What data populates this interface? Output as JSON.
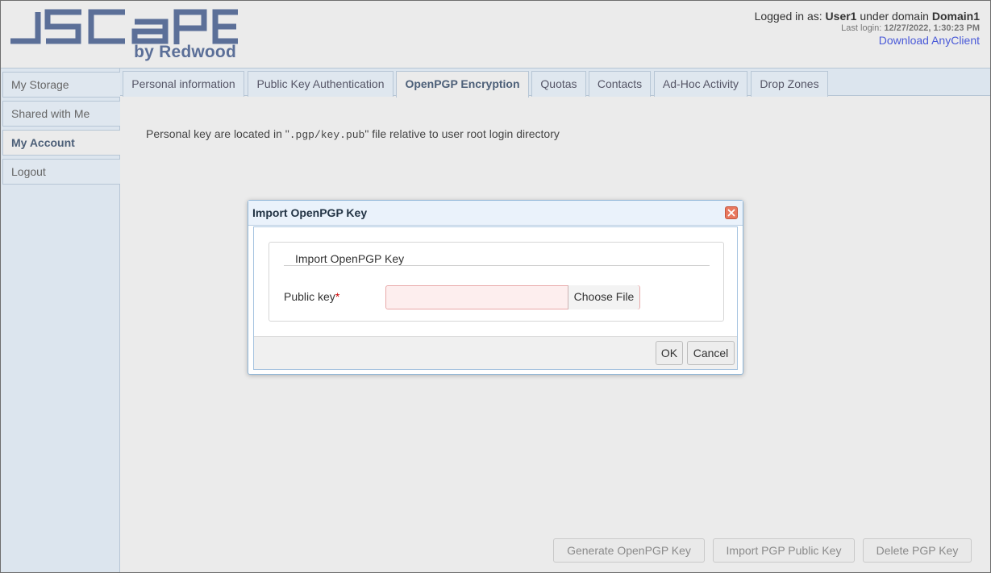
{
  "header": {
    "logo_sub": "by Redwood",
    "logged_in_prefix": "Logged in as: ",
    "user": "User1",
    "under_domain": " under domain ",
    "domain": "Domain1",
    "last_login_label": "Last login: ",
    "last_login_value": "12/27/2022, 1:30:23 PM",
    "download_link": "Download AnyClient"
  },
  "sidebar": {
    "items": [
      {
        "label": "My Storage"
      },
      {
        "label": "Shared with Me"
      },
      {
        "label": "My Account"
      },
      {
        "label": "Logout"
      }
    ]
  },
  "tabs": [
    {
      "label": "Personal information"
    },
    {
      "label": "Public Key Authentication"
    },
    {
      "label": "OpenPGP Encryption"
    },
    {
      "label": "Quotas"
    },
    {
      "label": "Contacts"
    },
    {
      "label": "Ad-Hoc Activity"
    },
    {
      "label": "Drop Zones"
    }
  ],
  "content": {
    "info_prefix": "Personal key are located in \"",
    "info_path": ".pgp/key.pub",
    "info_suffix": "\" file relative to user root login directory"
  },
  "actions": {
    "generate": "Generate OpenPGP Key",
    "import": "Import PGP Public Key",
    "delete": "Delete PGP Key"
  },
  "dialog": {
    "title": "Import OpenPGP Key",
    "legend": "Import OpenPGP Key",
    "field_label": "Public key",
    "required_mark": "*",
    "choose_file": "Choose File",
    "ok": "OK",
    "cancel": "Cancel"
  },
  "colors": {
    "brand": "#5b6f98",
    "link": "#4a5ad8",
    "sidebar_bg": "#dce5ee",
    "close_button": "#e8785f"
  },
  "icons": {
    "close": "close-icon"
  }
}
